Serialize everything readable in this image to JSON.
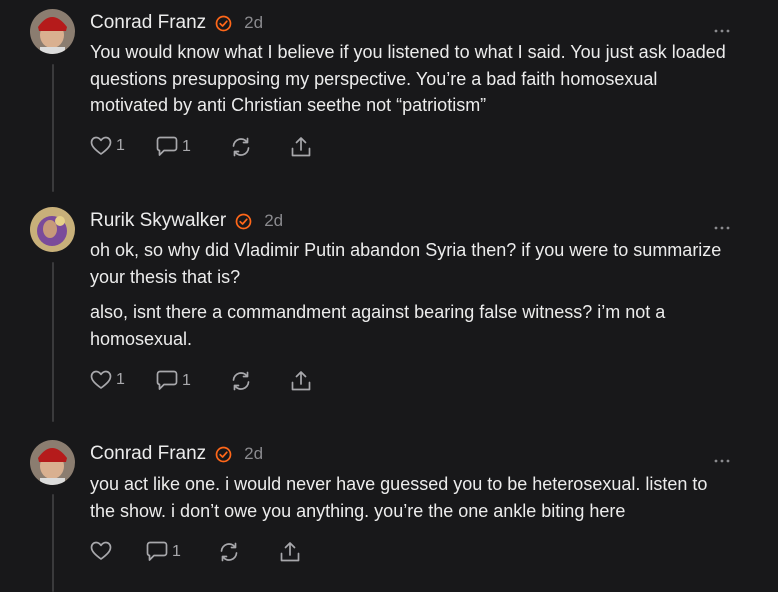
{
  "comments": [
    {
      "author": "Conrad Franz",
      "time": "2d",
      "paragraphs": [
        "You would know what I believe if you listened to what I said. You just ask loaded questions presupposing my perspective. You’re a bad faith homosexual motivated by anti Christian seethe not “patriotism”"
      ],
      "likes": "1",
      "replies": "1"
    },
    {
      "author": "Rurik Skywalker",
      "time": "2d",
      "paragraphs": [
        "oh ok, so why did Vladimir Putin abandon Syria then? if you were to summarize your thesis that is?",
        "also, isnt there a commandment against bearing false witness? i’m not a homosexual."
      ],
      "likes": "1",
      "replies": "1"
    },
    {
      "author": "Conrad Franz",
      "time": "2d",
      "paragraphs": [
        "you act like one. i would never have guessed you to be heterosexual. listen to the show. i don’t owe you anything. you’re the one ankle biting here"
      ],
      "likes": "",
      "replies": "1"
    }
  ],
  "icons": {
    "verified": "verified-badge-icon",
    "like": "heart-icon",
    "reply": "comment-bubble-icon",
    "restack": "restack-icon",
    "share": "share-icon",
    "more": "more-dots-icon"
  },
  "colors": {
    "background": "#18181a",
    "accent": "#ff6719",
    "text": "#ececec",
    "muted": "#8a8a8e"
  }
}
